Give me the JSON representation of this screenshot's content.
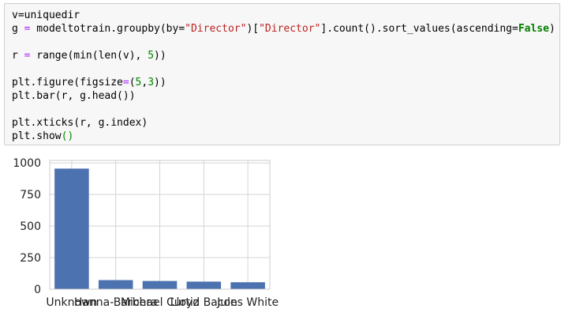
{
  "code_cell": {
    "lines": [
      [
        {
          "t": "v=uniquedir"
        }
      ],
      [
        {
          "t": "g "
        },
        {
          "t": "=",
          "c": "op"
        },
        {
          "t": " modeltotrain.groupby(by="
        },
        {
          "t": "\"Director\"",
          "c": "str"
        },
        {
          "t": ")["
        },
        {
          "t": "\"Director\"",
          "c": "str"
        },
        {
          "t": "].count().sort_values(ascending="
        },
        {
          "t": "False",
          "c": "kw"
        },
        {
          "t": ")"
        }
      ],
      [],
      [
        {
          "t": "r "
        },
        {
          "t": "=",
          "c": "op"
        },
        {
          "t": " range(min(len(v), "
        },
        {
          "t": "5",
          "c": "num"
        },
        {
          "t": "))"
        }
      ],
      [],
      [
        {
          "t": "plt.figure(figsize"
        },
        {
          "t": "=",
          "c": "op"
        },
        {
          "t": "("
        },
        {
          "t": "5",
          "c": "num"
        },
        {
          "t": ","
        },
        {
          "t": "3",
          "c": "num"
        },
        {
          "t": "))"
        }
      ],
      [
        {
          "t": "plt.bar(r, g.head())"
        }
      ],
      [],
      [
        {
          "t": "plt.xticks(r, g.index)"
        }
      ],
      [
        {
          "t": "plt.show"
        },
        {
          "t": "()",
          "c": "num"
        }
      ]
    ]
  },
  "chart_data": {
    "type": "bar",
    "categories": [
      "Unknown",
      "Hanna-Barbera",
      "Michael Curtiz",
      "Lloyd Bacon",
      "Jules White"
    ],
    "values": [
      955,
      72,
      65,
      60,
      55
    ],
    "ylim": [
      0,
      1020
    ],
    "yticks": [
      0,
      250,
      500,
      750,
      1000
    ],
    "ytick_labels": [
      "0",
      "250",
      "500",
      "750",
      "1000"
    ],
    "grid": true,
    "bar_color": "#4c72b0",
    "grid_color": "#d4d4d4",
    "title": "",
    "xlabel": "",
    "ylabel": ""
  }
}
